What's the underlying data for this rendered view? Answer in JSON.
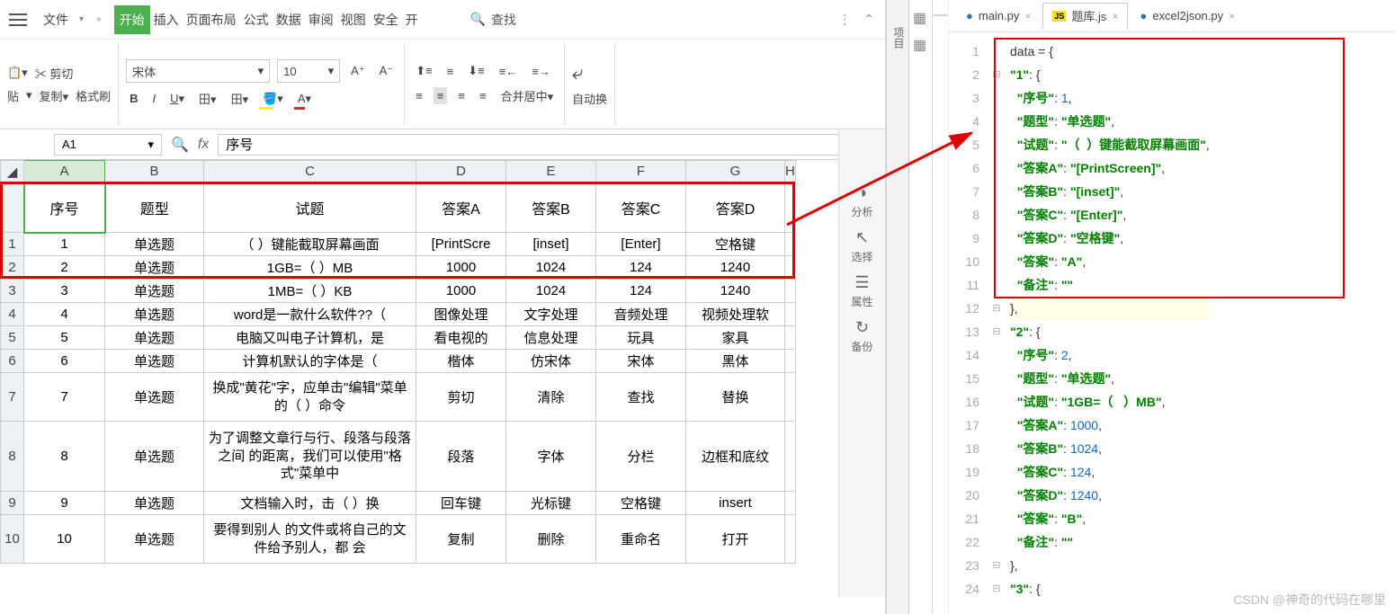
{
  "menubar": {
    "file": "文件",
    "tabs": [
      "开始",
      "插入",
      "页面布局",
      "公式",
      "数据",
      "审阅",
      "视图",
      "安全",
      "开"
    ],
    "search": "查找"
  },
  "toolbar": {
    "cut": "剪切",
    "paste": "贴",
    "copy": "复制",
    "format_painter": "格式刷",
    "font_name": "宋体",
    "font_size": "10",
    "merge": "合并居中",
    "autowrap": "自动换"
  },
  "cellref": {
    "name": "A1",
    "value": "序号"
  },
  "sheet": {
    "columns": [
      "A",
      "B",
      "C",
      "D",
      "E",
      "F",
      "G",
      "H"
    ],
    "headers": [
      "序号",
      "题型",
      "试题",
      "答案A",
      "答案B",
      "答案C",
      "答案D"
    ],
    "rows": [
      {
        "r": "1",
        "n": "1",
        "t": "单选题",
        "q": "（  ）键能截取屏幕画面",
        "a": "[PrintScre",
        "b": "[inset]",
        "c": "[Enter]",
        "d": "空格键"
      },
      {
        "r": "2",
        "n": "2",
        "t": "单选题",
        "q": "1GB=（   ）MB",
        "a": "1000",
        "b": "1024",
        "c": "124",
        "d": "1240"
      },
      {
        "r": "3",
        "n": "3",
        "t": "单选题",
        "q": "1MB=（   ）KB",
        "a": "1000",
        "b": "1024",
        "c": "124",
        "d": "1240"
      },
      {
        "r": "4",
        "n": "4",
        "t": "单选题",
        "q": "word是一款什么软件??（",
        "a": "图像处理",
        "b": "文字处理",
        "c": "音频处理",
        "d": "视频处理软"
      },
      {
        "r": "5",
        "n": "5",
        "t": "单选题",
        "q": "电脑又叫电子计算机，是",
        "a": "看电视的",
        "b": "信息处理",
        "c": "玩具",
        "d": "家具"
      },
      {
        "r": "6",
        "n": "6",
        "t": "单选题",
        "q": "计算机默认的字体是（",
        "a": "楷体",
        "b": "仿宋体",
        "c": "宋体",
        "d": "黑体"
      },
      {
        "r": "7",
        "n": "7",
        "t": "单选题",
        "q": "换成\"黄花\"字，应单击\"编辑\"菜单的（   ）命令",
        "a": "剪切",
        "b": "清除",
        "c": "查找",
        "d": "替换",
        "tall": true
      },
      {
        "r": "8",
        "n": "8",
        "t": "单选题",
        "q": "为了调整文章行与行、段落与段落之间 的距离，我们可以使用\"格式\"菜单中",
        "a": "段落",
        "b": "字体",
        "c": "分栏",
        "d": "边框和底纹",
        "tall3": true
      },
      {
        "r": "9",
        "n": "9",
        "t": "单选题",
        "q": "文档输入时，击（  ）换",
        "a": "回车键",
        "b": "光标键",
        "c": "空格键",
        "d": "insert"
      },
      {
        "r": "10",
        "n": "10",
        "t": "单选题",
        "q": "要得到别人 的文件或将自己的文件给予别人，都 会",
        "a": "复制",
        "b": "删除",
        "c": "重命名",
        "d": "打开",
        "tall": true
      }
    ]
  },
  "sidepanel": {
    "analyze": "分析",
    "select": "选择",
    "props": "属性",
    "backup": "备份"
  },
  "project_label": "项目",
  "editor": {
    "tabs": [
      {
        "icon": "py",
        "label": "main.py"
      },
      {
        "icon": "js",
        "label": "题库.js",
        "active": true
      },
      {
        "icon": "py",
        "label": "excel2json.py"
      }
    ],
    "code_lines": [
      {
        "n": 1,
        "g": "",
        "txt": [
          {
            "c": "punc",
            "v": "data = {"
          }
        ]
      },
      {
        "n": 2,
        "g": "⊟",
        "txt": [
          {
            "c": "str",
            "v": "\"1\""
          },
          {
            "c": "punc",
            "v": ": {"
          }
        ]
      },
      {
        "n": 3,
        "g": "",
        "txt": [
          {
            "c": "str",
            "v": "  \"序号\""
          },
          {
            "c": "punc",
            "v": ": "
          },
          {
            "c": "num",
            "v": "1"
          },
          {
            "c": "punc",
            "v": ","
          }
        ]
      },
      {
        "n": 4,
        "g": "",
        "txt": [
          {
            "c": "str",
            "v": "  \"题型\""
          },
          {
            "c": "punc",
            "v": ": "
          },
          {
            "c": "str",
            "v": "\"单选题\""
          },
          {
            "c": "punc",
            "v": ","
          }
        ]
      },
      {
        "n": 5,
        "g": "",
        "txt": [
          {
            "c": "str",
            "v": "  \"试题\""
          },
          {
            "c": "punc",
            "v": ": "
          },
          {
            "c": "str",
            "v": "\"（  ）键能截取屏幕画面\""
          },
          {
            "c": "punc",
            "v": ","
          }
        ]
      },
      {
        "n": 6,
        "g": "",
        "txt": [
          {
            "c": "str",
            "v": "  \"答案A\""
          },
          {
            "c": "punc",
            "v": ": "
          },
          {
            "c": "str",
            "v": "\"[PrintScreen]\""
          },
          {
            "c": "punc",
            "v": ","
          }
        ]
      },
      {
        "n": 7,
        "g": "",
        "txt": [
          {
            "c": "str",
            "v": "  \"答案B\""
          },
          {
            "c": "punc",
            "v": ": "
          },
          {
            "c": "str",
            "v": "\"[inset]\""
          },
          {
            "c": "punc",
            "v": ","
          }
        ]
      },
      {
        "n": 8,
        "g": "",
        "txt": [
          {
            "c": "str",
            "v": "  \"答案C\""
          },
          {
            "c": "punc",
            "v": ": "
          },
          {
            "c": "str",
            "v": "\"[Enter]\""
          },
          {
            "c": "punc",
            "v": ","
          }
        ]
      },
      {
        "n": 9,
        "g": "",
        "txt": [
          {
            "c": "str",
            "v": "  \"答案D\""
          },
          {
            "c": "punc",
            "v": ": "
          },
          {
            "c": "str",
            "v": "\"空格键\""
          },
          {
            "c": "punc",
            "v": ","
          }
        ]
      },
      {
        "n": 10,
        "g": "",
        "txt": [
          {
            "c": "str",
            "v": "  \"答案\""
          },
          {
            "c": "punc",
            "v": ": "
          },
          {
            "c": "str",
            "v": "\"A\""
          },
          {
            "c": "punc",
            "v": ","
          }
        ]
      },
      {
        "n": 11,
        "g": "",
        "txt": [
          {
            "c": "str",
            "v": "  \"备注\""
          },
          {
            "c": "punc",
            "v": ": "
          },
          {
            "c": "str",
            "v": "\"\""
          }
        ]
      },
      {
        "n": 12,
        "g": "⊟",
        "hl": true,
        "txt": [
          {
            "c": "punc",
            "v": "},"
          }
        ]
      },
      {
        "n": 13,
        "g": "⊟",
        "txt": [
          {
            "c": "str",
            "v": "\"2\""
          },
          {
            "c": "punc",
            "v": ": {"
          }
        ]
      },
      {
        "n": 14,
        "g": "",
        "txt": [
          {
            "c": "str",
            "v": "  \"序号\""
          },
          {
            "c": "punc",
            "v": ": "
          },
          {
            "c": "num",
            "v": "2"
          },
          {
            "c": "punc",
            "v": ","
          }
        ]
      },
      {
        "n": 15,
        "g": "",
        "txt": [
          {
            "c": "str",
            "v": "  \"题型\""
          },
          {
            "c": "punc",
            "v": ": "
          },
          {
            "c": "str",
            "v": "\"单选题\""
          },
          {
            "c": "punc",
            "v": ","
          }
        ]
      },
      {
        "n": 16,
        "g": "",
        "txt": [
          {
            "c": "str",
            "v": "  \"试题\""
          },
          {
            "c": "punc",
            "v": ": "
          },
          {
            "c": "str",
            "v": "\"1GB=（   ）MB\""
          },
          {
            "c": "punc",
            "v": ","
          }
        ]
      },
      {
        "n": 17,
        "g": "",
        "txt": [
          {
            "c": "str",
            "v": "  \"答案A\""
          },
          {
            "c": "punc",
            "v": ": "
          },
          {
            "c": "num",
            "v": "1000"
          },
          {
            "c": "punc",
            "v": ","
          }
        ]
      },
      {
        "n": 18,
        "g": "",
        "txt": [
          {
            "c": "str",
            "v": "  \"答案B\""
          },
          {
            "c": "punc",
            "v": ": "
          },
          {
            "c": "num",
            "v": "1024"
          },
          {
            "c": "punc",
            "v": ","
          }
        ]
      },
      {
        "n": 19,
        "g": "",
        "txt": [
          {
            "c": "str",
            "v": "  \"答案C\""
          },
          {
            "c": "punc",
            "v": ": "
          },
          {
            "c": "num",
            "v": "124"
          },
          {
            "c": "punc",
            "v": ","
          }
        ]
      },
      {
        "n": 20,
        "g": "",
        "txt": [
          {
            "c": "str",
            "v": "  \"答案D\""
          },
          {
            "c": "punc",
            "v": ": "
          },
          {
            "c": "num",
            "v": "1240"
          },
          {
            "c": "punc",
            "v": ","
          }
        ]
      },
      {
        "n": 21,
        "g": "",
        "txt": [
          {
            "c": "str",
            "v": "  \"答案\""
          },
          {
            "c": "punc",
            "v": ": "
          },
          {
            "c": "str",
            "v": "\"B\""
          },
          {
            "c": "punc",
            "v": ","
          }
        ]
      },
      {
        "n": 22,
        "g": "",
        "txt": [
          {
            "c": "str",
            "v": "  \"备注\""
          },
          {
            "c": "punc",
            "v": ": "
          },
          {
            "c": "str",
            "v": "\"\""
          }
        ]
      },
      {
        "n": 23,
        "g": "⊟",
        "txt": [
          {
            "c": "punc",
            "v": "},"
          }
        ]
      },
      {
        "n": 24,
        "g": "⊟",
        "txt": [
          {
            "c": "str",
            "v": "\"3\""
          },
          {
            "c": "punc",
            "v": ": {"
          }
        ]
      }
    ]
  },
  "watermark": "CSDN @神奇的代码在哪里"
}
